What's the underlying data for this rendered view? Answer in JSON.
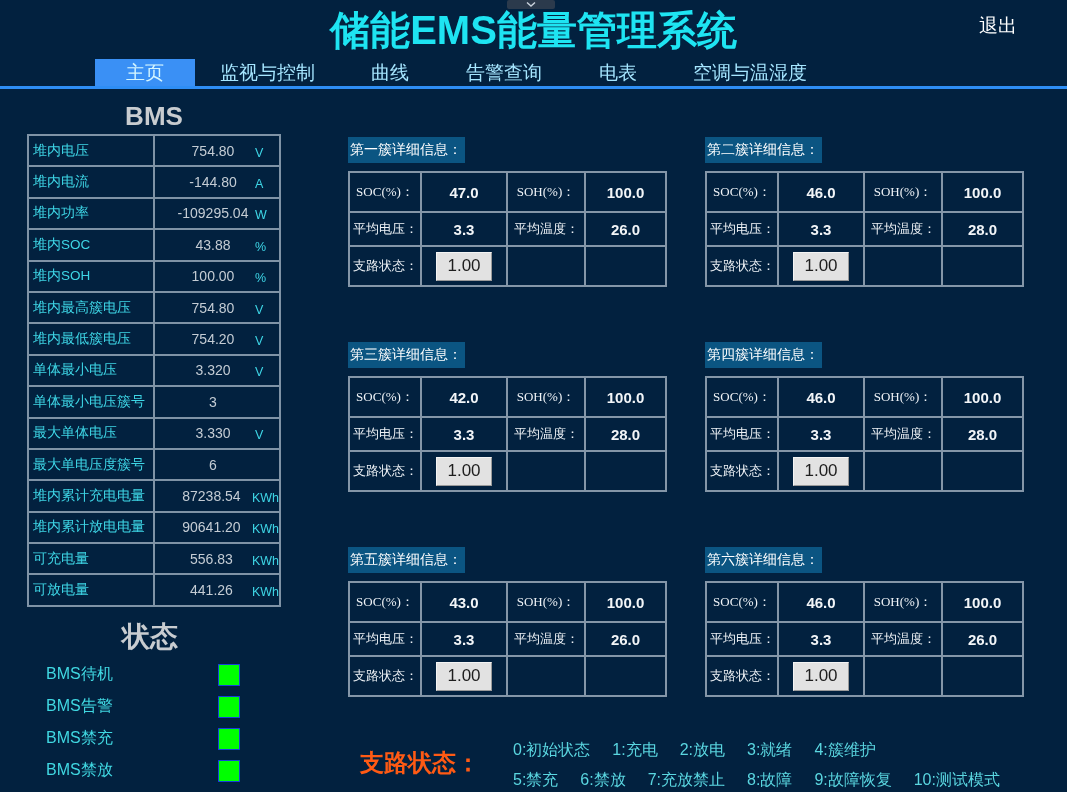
{
  "header": {
    "title": "储能EMS能量管理系统",
    "logout": "退出"
  },
  "tabs": [
    {
      "label": "主页",
      "selected": true
    },
    {
      "label": "监视与控制",
      "selected": false
    },
    {
      "label": "曲线",
      "selected": false
    },
    {
      "label": "告警查询",
      "selected": false
    },
    {
      "label": "电表",
      "selected": false
    },
    {
      "label": "空调与温湿度",
      "selected": false
    }
  ],
  "bms": {
    "title": "BMS",
    "rows": [
      {
        "label": "堆内电压",
        "value": "754.80",
        "unit": "V"
      },
      {
        "label": "堆内电流",
        "value": "-144.80",
        "unit": "A"
      },
      {
        "label": "堆内功率",
        "value": "-109295.04",
        "unit": "W"
      },
      {
        "label": "堆内SOC",
        "value": "43.88",
        "unit": "%"
      },
      {
        "label": "堆内SOH",
        "value": "100.00",
        "unit": "%"
      },
      {
        "label": "堆内最高簇电压",
        "value": "754.80",
        "unit": "V"
      },
      {
        "label": "堆内最低簇电压",
        "value": "754.20",
        "unit": "V"
      },
      {
        "label": "单体最小电压",
        "value": "3.320",
        "unit": "V"
      },
      {
        "label": "单体最小电压簇号",
        "value": "3"
      },
      {
        "label": "最大单体电压",
        "value": "3.330",
        "unit": "V"
      },
      {
        "label": "最大单电压度簇号",
        "value": "6"
      },
      {
        "label": "堆内累计充电电量",
        "value": "87238.54",
        "unit": "KWh"
      },
      {
        "label": "堆内累计放电电量",
        "value": "90641.20",
        "unit": "KWh"
      },
      {
        "label": "可充电量",
        "value": "556.83",
        "unit": "KWh"
      },
      {
        "label": "可放电量",
        "value": "441.26",
        "unit": "KWh"
      }
    ]
  },
  "status": {
    "title": "状态",
    "indicators": [
      {
        "label": "BMS待机",
        "on": true
      },
      {
        "label": "BMS告警",
        "on": true
      },
      {
        "label": "BMS禁充",
        "on": true
      },
      {
        "label": "BMS禁放",
        "on": true
      }
    ]
  },
  "clusters": [
    {
      "title": "第一簇详细信息：",
      "rows": [
        [
          {
            "label": "SOC(%)：",
            "value": "47.0",
            "kind": "text"
          },
          {
            "label": "SOH(%)：",
            "value": "100.0",
            "kind": "text"
          }
        ],
        [
          {
            "label": "平均电压：",
            "value": "3.3",
            "kind": "text"
          },
          {
            "label": "平均温度：",
            "value": "26.0",
            "kind": "text"
          }
        ],
        [
          {
            "label": "支路状态：",
            "value": "1.00",
            "kind": "button"
          }
        ]
      ]
    },
    {
      "title": "第二簇详细信息：",
      "rows": [
        [
          {
            "label": "SOC(%)：",
            "value": "46.0",
            "kind": "text"
          },
          {
            "label": "SOH(%)：",
            "value": "100.0",
            "kind": "text"
          }
        ],
        [
          {
            "label": "平均电压：",
            "value": "3.3",
            "kind": "text"
          },
          {
            "label": "平均温度：",
            "value": "28.0",
            "kind": "text"
          }
        ],
        [
          {
            "label": "支路状态：",
            "value": "1.00",
            "kind": "button"
          }
        ]
      ]
    },
    {
      "title": "第三簇详细信息：",
      "rows": [
        [
          {
            "label": "SOC(%)：",
            "value": "42.0",
            "kind": "text"
          },
          {
            "label": "SOH(%)：",
            "value": "100.0",
            "kind": "text"
          }
        ],
        [
          {
            "label": "平均电压：",
            "value": "3.3",
            "kind": "text"
          },
          {
            "label": "平均温度：",
            "value": "28.0",
            "kind": "text"
          }
        ],
        [
          {
            "label": "支路状态：",
            "value": "1.00",
            "kind": "button"
          }
        ]
      ]
    },
    {
      "title": "第四簇详细信息：",
      "rows": [
        [
          {
            "label": "SOC(%)：",
            "value": "46.0",
            "kind": "text"
          },
          {
            "label": "SOH(%)：",
            "value": "100.0",
            "kind": "text"
          }
        ],
        [
          {
            "label": "平均电压：",
            "value": "3.3",
            "kind": "text"
          },
          {
            "label": "平均温度：",
            "value": "28.0",
            "kind": "text"
          }
        ],
        [
          {
            "label": "支路状态：",
            "value": "1.00",
            "kind": "button"
          }
        ]
      ]
    },
    {
      "title": "第五簇详细信息：",
      "rows": [
        [
          {
            "label": "SOC(%)：",
            "value": "43.0",
            "kind": "text"
          },
          {
            "label": "SOH(%)：",
            "value": "100.0",
            "kind": "text"
          }
        ],
        [
          {
            "label": "平均电压：",
            "value": "3.3",
            "kind": "text"
          },
          {
            "label": "平均温度：",
            "value": "26.0",
            "kind": "text"
          }
        ],
        [
          {
            "label": "支路状态：",
            "value": "1.00",
            "kind": "button"
          }
        ]
      ]
    },
    {
      "title": "第六簇详细信息：",
      "rows": [
        [
          {
            "label": "SOC(%)：",
            "value": "46.0",
            "kind": "text"
          },
          {
            "label": "SOH(%)：",
            "value": "100.0",
            "kind": "text"
          }
        ],
        [
          {
            "label": "平均电压：",
            "value": "3.3",
            "kind": "text"
          },
          {
            "label": "平均温度：",
            "value": "26.0",
            "kind": "text"
          }
        ],
        [
          {
            "label": "支路状态：",
            "value": "1.00",
            "kind": "button"
          }
        ]
      ]
    }
  ],
  "branch_status_legend": {
    "title": "支路状态：",
    "rows": [
      [
        "0:初始状态",
        "1:充电",
        "2:放电",
        "3:就绪",
        "4:簇维护"
      ],
      [
        "5:禁充",
        "6:禁放",
        "7:充放禁止",
        "8:故障",
        "9:故障恢复",
        "10:测试模式"
      ]
    ]
  }
}
